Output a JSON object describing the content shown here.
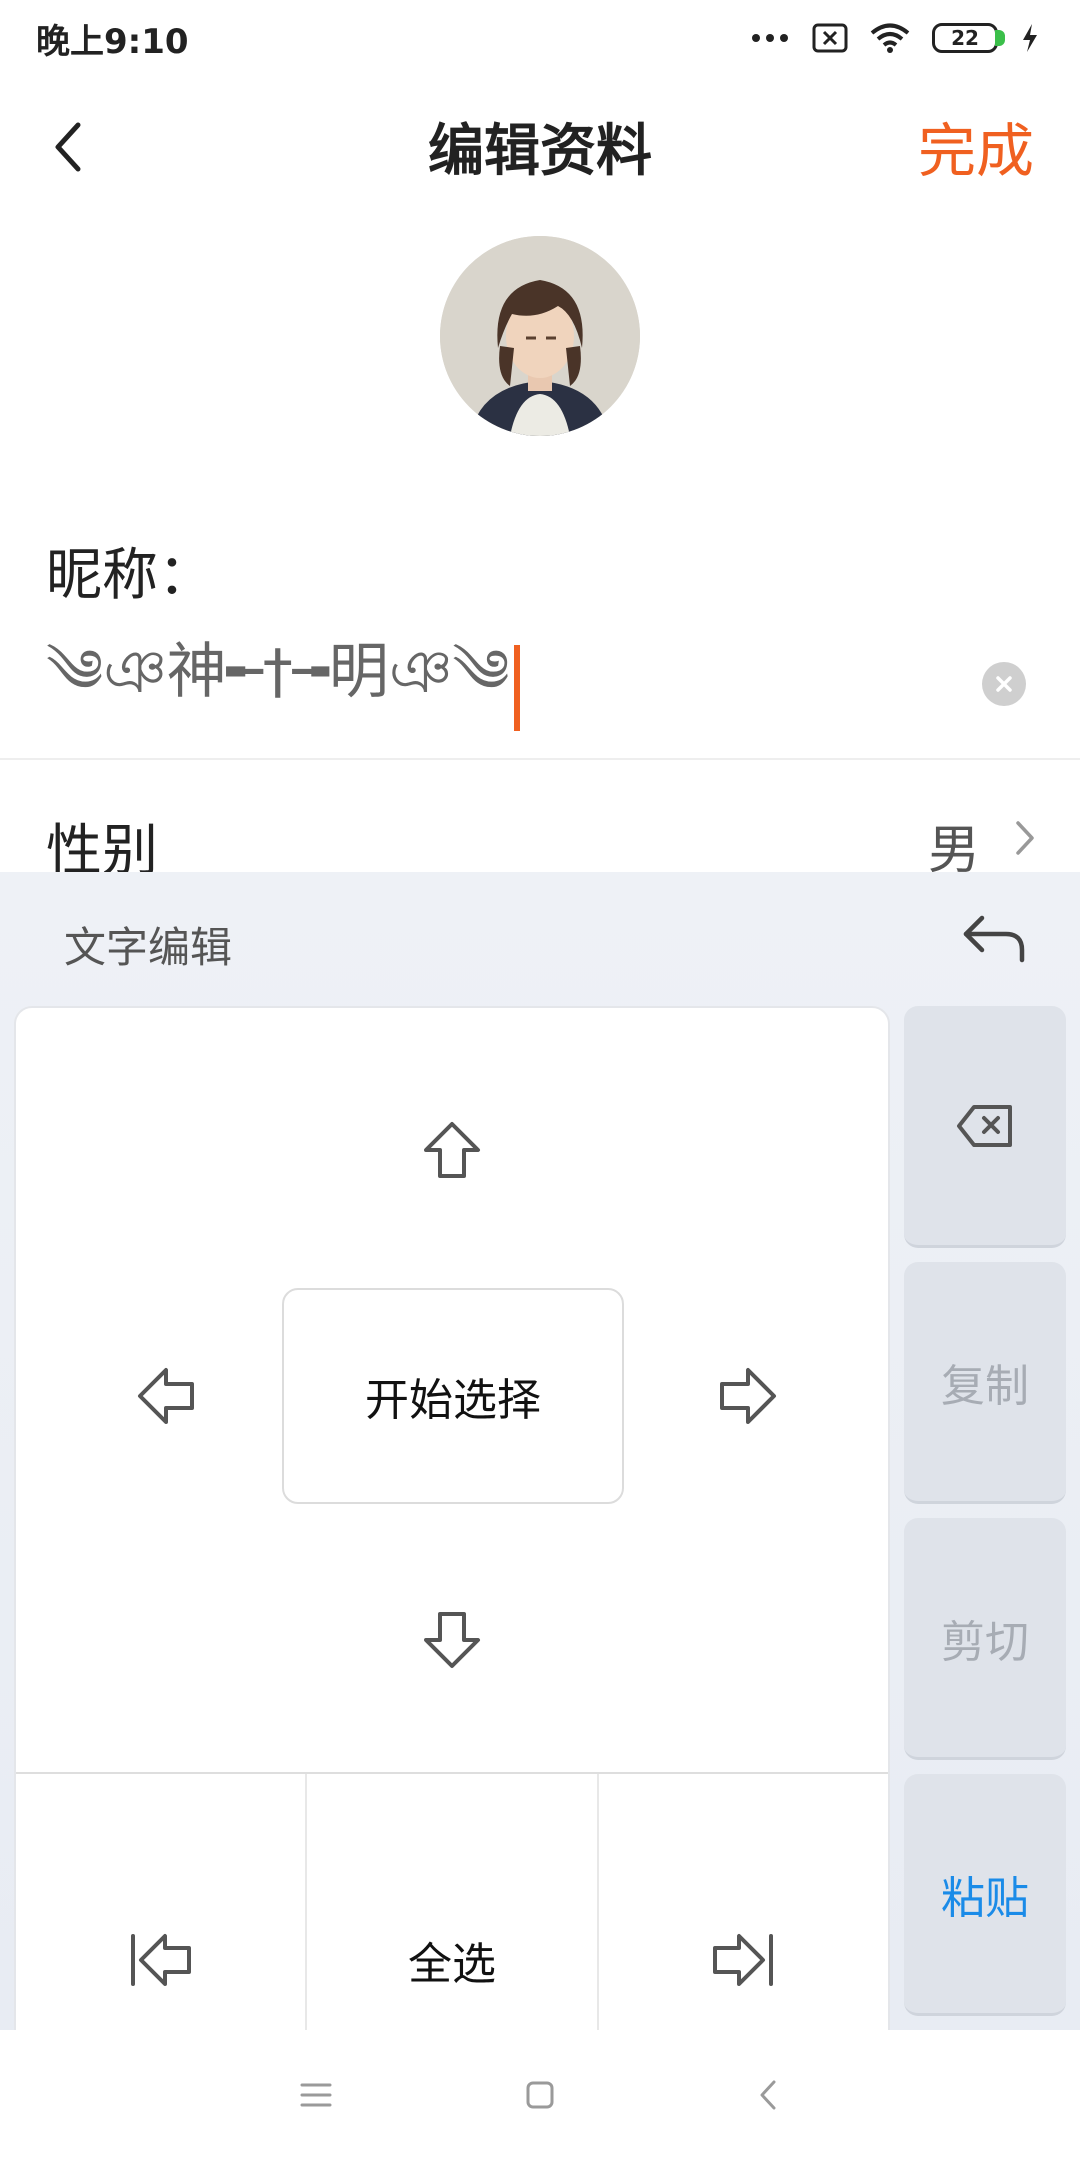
{
  "status_bar": {
    "time": "晚上9:10",
    "battery_level": "22",
    "icons": [
      "more-dots-icon",
      "sim-error-icon",
      "wifi-icon",
      "battery-icon",
      "charging-icon"
    ]
  },
  "header": {
    "title": "编辑资料",
    "done_label": "完成",
    "accent_color": "#f06020"
  },
  "profile": {
    "nickname_label": "昵称：",
    "nickname_value": "༄ঞ神╾†╼明ঞ༄",
    "gender_label": "性别",
    "gender_value": "男"
  },
  "text_edit_panel": {
    "title": "文字编辑",
    "start_select_label": "开始选择",
    "select_all_label": "全选",
    "copy_label": "复制",
    "cut_label": "剪切",
    "paste_label": "粘贴",
    "paste_color": "#1a8be8"
  },
  "nav_bar": {
    "items": [
      "menu-icon",
      "home-icon",
      "back-icon"
    ]
  }
}
